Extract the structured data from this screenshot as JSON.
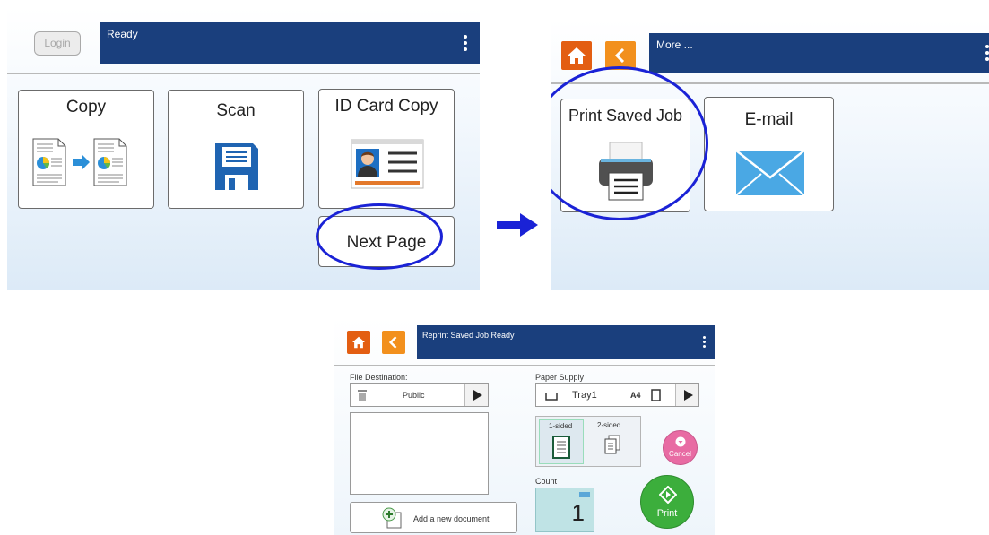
{
  "panel1": {
    "login_label": "Login",
    "status": "Ready",
    "tiles": {
      "copy": "Copy",
      "scan": "Scan",
      "id_card_copy": "ID Card Copy",
      "next_page": "Next Page"
    }
  },
  "panel2": {
    "status": "More ...",
    "tiles": {
      "print_saved_job": "Print Saved Job",
      "email": "E-mail"
    }
  },
  "panel3": {
    "title": "Reprint Saved Job  Ready",
    "file_destination_label": "File Destination:",
    "destination_value": "Public",
    "paper_supply_label": "Paper Supply",
    "tray_value": "Tray1",
    "paper_size": "A4",
    "one_sided": "1-sided",
    "two_sided": "2-sided",
    "cancel_label": "Cancel",
    "count_label": "Count",
    "count_value": "1",
    "print_label": "Print",
    "add_document": "Add a new document"
  },
  "colors": {
    "header_blue": "#1a3f7d",
    "home_orange": "#e35e12",
    "back_orange": "#f2901d",
    "highlight_circle": "#1a22d6",
    "print_green": "#3cae3c",
    "cancel_pink": "#e86ba3"
  }
}
